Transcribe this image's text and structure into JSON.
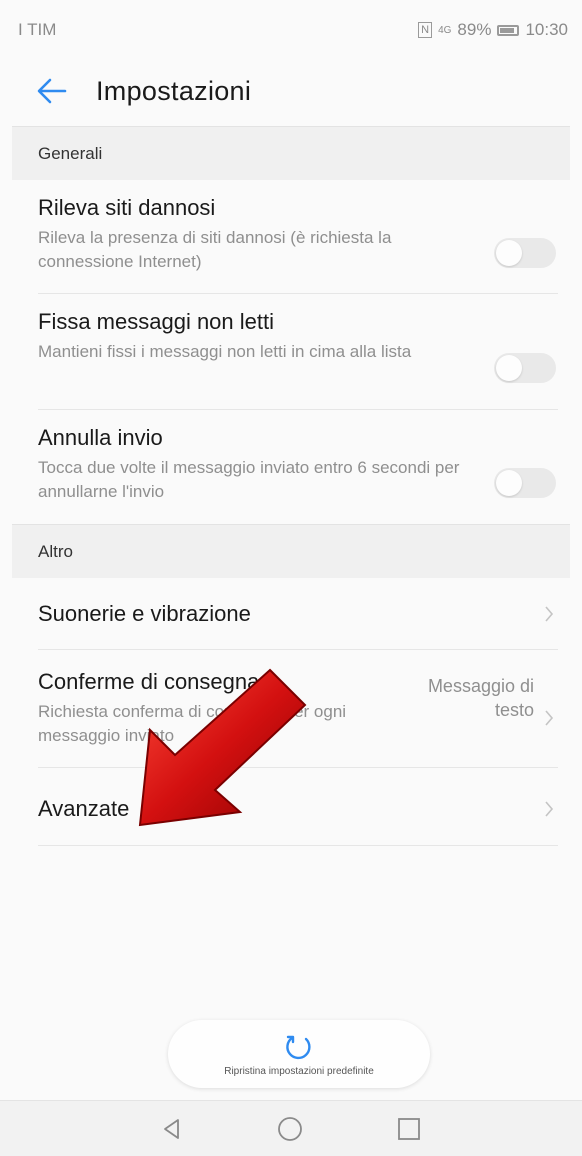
{
  "status_bar": {
    "carrier": "I TIM",
    "nfc": "N",
    "signal": "4G",
    "battery": "89%",
    "time": "10:30"
  },
  "app_bar": {
    "back_icon": "back-arrow-icon",
    "title": "Impostazioni"
  },
  "sections": [
    {
      "header": "Generali",
      "items": [
        {
          "title": "Rileva siti dannosi",
          "subtitle": "Rileva la presenza di siti dannosi (è richiesta la connessione Internet)",
          "control": "toggle",
          "on": false
        },
        {
          "title": "Fissa messaggi non letti",
          "subtitle": "Mantieni fissi i messaggi non letti in cima alla lista",
          "control": "toggle",
          "on": false
        },
        {
          "title": "Annulla invio",
          "subtitle": "Tocca due volte il messaggio inviato entro 6 secondi per annullarne l'invio",
          "control": "toggle",
          "on": false
        }
      ]
    },
    {
      "header": "Altro",
      "items": [
        {
          "title": "Suonerie e vibrazione",
          "control": "chevron"
        },
        {
          "title": "Conferme di consegna",
          "subtitle": "Richiesta conferma di consegna per ogni messaggio inviato",
          "value_line1": "Messaggio di",
          "value_line2": "testo",
          "control": "chevron"
        },
        {
          "title": "Avanzate",
          "control": "chevron"
        }
      ]
    }
  ],
  "reset": {
    "icon": "refresh-icon",
    "label": "Ripristina impostazioni predefinite"
  },
  "nav": {
    "back": "nav-back-icon",
    "home": "nav-home-icon",
    "recents": "nav-recents-icon"
  },
  "colors": {
    "accent": "#2f8bf0",
    "annotation_arrow": "#cc1111"
  }
}
